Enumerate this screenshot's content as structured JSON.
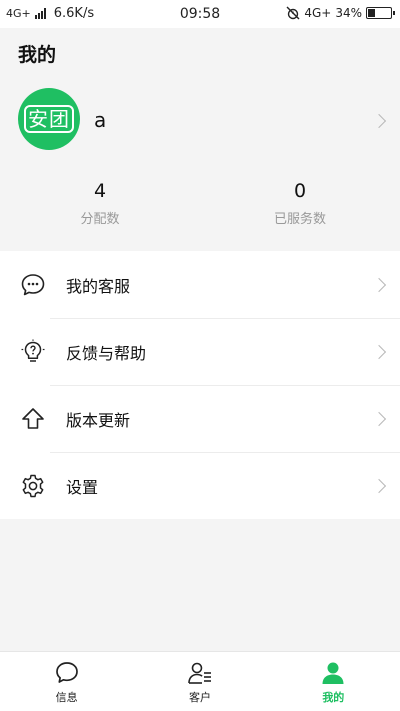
{
  "status_bar": {
    "network": "4G+",
    "speed": "6.6K/s",
    "time": "09:58",
    "network_right": "4G+",
    "battery": "34%",
    "battery_level": 0.34
  },
  "page": {
    "title": "我的"
  },
  "profile": {
    "avatar_text": "安团",
    "name": "a",
    "avatar_color": "#1fbf62"
  },
  "stats": [
    {
      "value": "4",
      "label": "分配数"
    },
    {
      "value": "0",
      "label": "已服务数"
    }
  ],
  "menu": [
    {
      "label": "我的客服",
      "icon": "chat-bubble-icon"
    },
    {
      "label": "反馈与帮助",
      "icon": "lightbulb-question-icon"
    },
    {
      "label": "版本更新",
      "icon": "upload-arrow-icon"
    },
    {
      "label": "设置",
      "icon": "gear-icon"
    }
  ],
  "bottom_nav": [
    {
      "label": "信息",
      "icon": "message-icon",
      "active": false
    },
    {
      "label": "客户",
      "icon": "customer-list-icon",
      "active": false
    },
    {
      "label": "我的",
      "icon": "person-icon",
      "active": true
    }
  ],
  "colors": {
    "accent": "#1fbf62",
    "background": "#f4f4f4"
  }
}
